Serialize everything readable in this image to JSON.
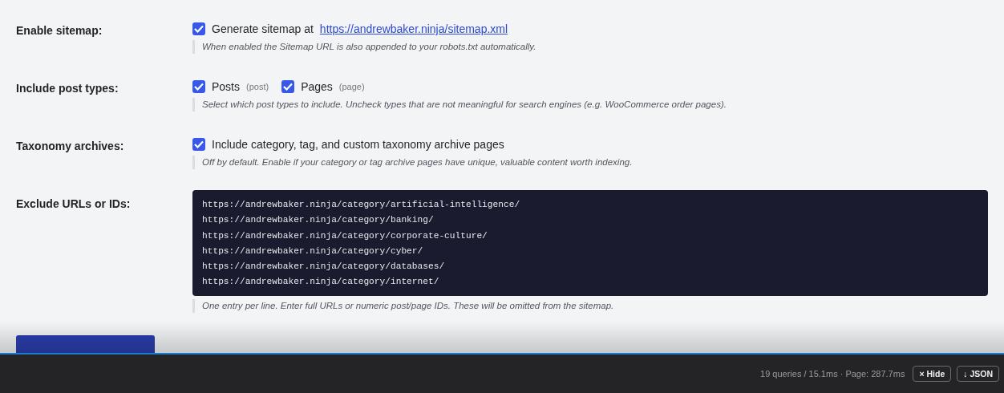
{
  "settings": [
    {
      "kind": "checkboxes",
      "label": "Enable sitemap:",
      "options": [
        {
          "text": "Generate sitemap at ",
          "link": "https://andrewbaker.ninja/sitemap.xml",
          "checked": true
        }
      ],
      "hint": "When enabled the Sitemap URL is also appended to your robots.txt automatically."
    },
    {
      "kind": "checkboxes",
      "label": "Include post types:",
      "options": [
        {
          "text": "Posts",
          "slug": "(post)",
          "checked": true
        },
        {
          "text": "Pages",
          "slug": "(page)",
          "checked": true
        }
      ],
      "hint": "Select which post types to include. Uncheck types that are not meaningful for search engines (e.g. WooCommerce order pages)."
    },
    {
      "kind": "checkboxes",
      "label": "Taxonomy archives:",
      "options": [
        {
          "text": "Include category, tag, and custom taxonomy archive pages",
          "checked": true
        }
      ],
      "hint": "Off by default. Enable if your category or tag archive pages have unique, valuable content worth indexing."
    },
    {
      "kind": "textarea",
      "label": "Exclude URLs or IDs:",
      "lines": [
        "https://andrewbaker.ninja/category/artificial-intelligence/",
        "https://andrewbaker.ninja/category/banking/",
        "https://andrewbaker.ninja/category/corporate-culture/",
        "https://andrewbaker.ninja/category/cyber/",
        "https://andrewbaker.ninja/category/databases/",
        "https://andrewbaker.ninja/category/internet/"
      ],
      "hint": "One entry per line. Enter full URLs or numeric post/page IDs. These will be omitted from the sitemap."
    }
  ],
  "debug_bar": {
    "stats": "19 queries / 15.1ms · Page: 287.7ms",
    "buttons": [
      {
        "icon": "×",
        "label": "Hide"
      },
      {
        "icon": "↓",
        "label": "JSON"
      }
    ]
  }
}
